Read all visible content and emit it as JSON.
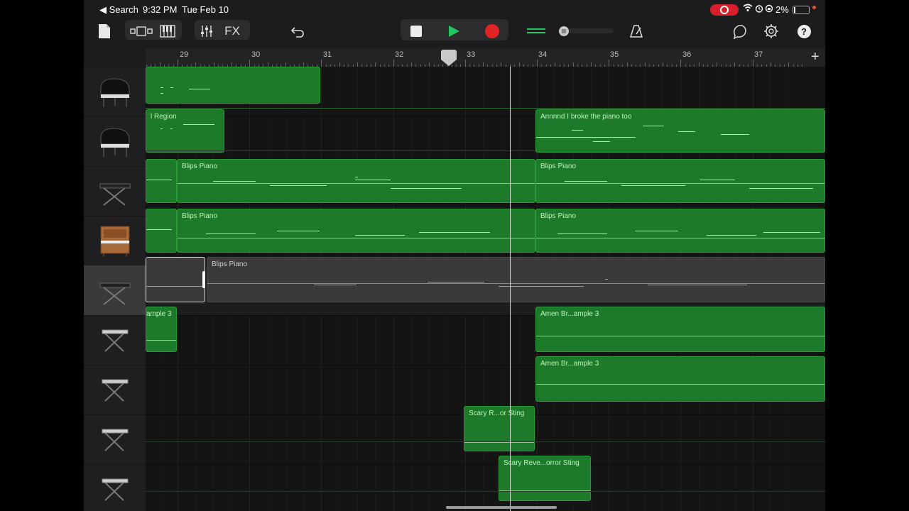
{
  "status": {
    "back_label": "◀ Search",
    "time": "9:32 PM",
    "date": "Tue Feb 10",
    "battery": "2%"
  },
  "toolbar": {
    "fx_label": "FX",
    "help_label": "?"
  },
  "colors": {
    "region_green": "#1c7a2a",
    "play_green": "#22c55e",
    "record_red": "#e02424",
    "playhead": "#d8d8d8"
  },
  "ruler": {
    "bars": [
      "29",
      "30",
      "31",
      "32",
      "33",
      "34",
      "35",
      "36",
      "37"
    ],
    "add_label": "+"
  },
  "tracks": [
    {
      "icon": "grand-piano-icon",
      "selected": false
    },
    {
      "icon": "grand-piano-icon",
      "selected": false
    },
    {
      "icon": "keyboard-stand-icon",
      "selected": false
    },
    {
      "icon": "upright-piano-icon",
      "selected": false
    },
    {
      "icon": "keyboard-stand-icon",
      "selected": true
    },
    {
      "icon": "keyboard-stand-icon",
      "selected": false
    },
    {
      "icon": "keyboard-stand-icon",
      "selected": false
    },
    {
      "icon": "keyboard-stand-icon",
      "selected": false
    },
    {
      "icon": "keyboard-stand-icon",
      "selected": false
    }
  ],
  "regions": {
    "t2_left": "l Region",
    "t2_right": "Annnnd I broke the piano too",
    "t3_a": "Blips Piano",
    "t3_b": "Blips Piano",
    "t4_a": "Blips Piano",
    "t4_b": "Blips Piano",
    "t5_a": "Blips Piano",
    "t6_left": "ample 3",
    "t6_right": "Amen Br...ample 3",
    "t7_right": "Amen Br...ample 3",
    "t8": "Scary R...or Sting",
    "t9": "Scary Reve...orror Sting"
  }
}
